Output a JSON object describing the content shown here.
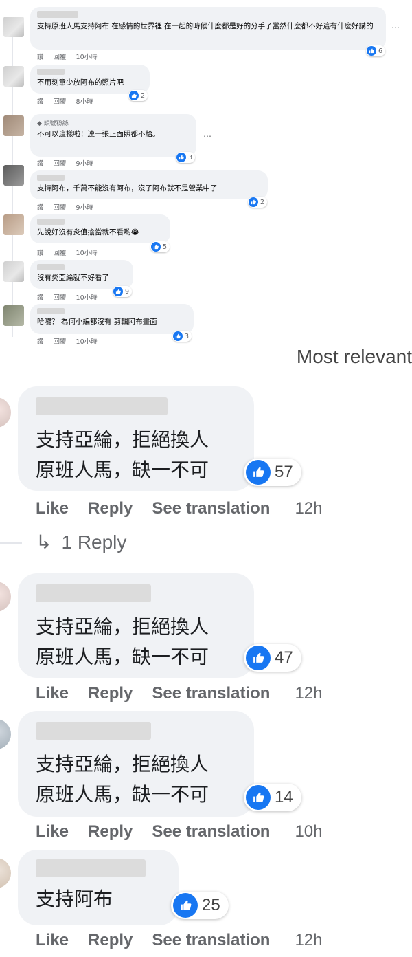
{
  "small_thread": {
    "action_like": "讚",
    "action_reply": "回覆",
    "more_glyph": "…",
    "comments": [
      {
        "text": "支持原班人馬支持阿布 在感情的世界裡 在一起的時候什麼都是好的分手了當然什麼都不好這有什麼好講的",
        "time": "10小時",
        "reactions": "6"
      },
      {
        "text": "不用刻意少放阿布的照片吧",
        "time": "8小時",
        "reactions": "2"
      },
      {
        "badge": "頭號粉絲",
        "text": "不可以這樣啦！連一張正面照都不給。",
        "time": "9小時",
        "reactions": "3"
      },
      {
        "text": "支持阿布，千萬不能沒有阿布，沒了阿布就不是營業中了",
        "time": "9小時",
        "reactions": "2"
      },
      {
        "text": "先說好沒有炎值擔當就不看喲😭",
        "time": "10小時",
        "reactions": "5"
      },
      {
        "text": "沒有炎亞綸就不好看了",
        "time": "10小時",
        "reactions": "9"
      },
      {
        "text": "哈囉？ 為何小編都沒有 剪輯阿布畫面",
        "time": "10小時",
        "reactions": "3"
      }
    ]
  },
  "large_thread": {
    "filter_label": "Most relevant",
    "actions": {
      "like": "Like",
      "reply": "Reply",
      "translate": "See translation"
    },
    "reply_toggle": "1 Reply",
    "comments": [
      {
        "text": "支持亞綸，拒絕換人\n原班人馬，缺一不可",
        "reactions": "57",
        "time": "12h"
      },
      {
        "text": "支持亞綸，拒絕換人\n原班人馬，缺一不可",
        "reactions": "47",
        "time": "12h"
      },
      {
        "text": "支持亞綸，拒絕換人\n原班人馬，缺一不可",
        "reactions": "14",
        "time": "10h"
      },
      {
        "text": "支持阿布",
        "reactions": "25",
        "time": "12h"
      }
    ]
  },
  "colors": {
    "like_blue": "#1877f2",
    "bubble_gray": "#f0f2f5",
    "meta_gray": "#65676b"
  }
}
